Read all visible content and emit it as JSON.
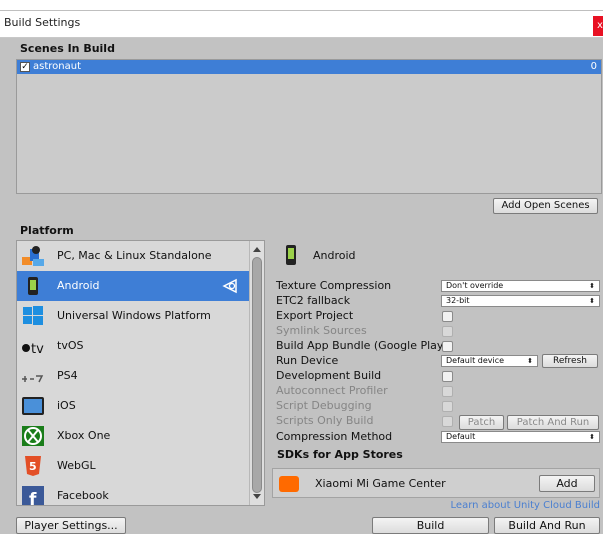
{
  "window": {
    "title": "Build Settings",
    "close_label": "x"
  },
  "scenes": {
    "heading": "Scenes In Build",
    "items": [
      {
        "name": "astronaut",
        "index": "0",
        "checked": true
      }
    ],
    "add_open_scenes_label": "Add Open Scenes"
  },
  "platform": {
    "heading": "Platform",
    "items": [
      {
        "label": "PC, Mac & Linux Standalone",
        "icon": "pc-mac-linux-icon"
      },
      {
        "label": "Android",
        "icon": "android-icon",
        "selected": true
      },
      {
        "label": "Universal Windows Platform",
        "icon": "windows-icon"
      },
      {
        "label": "tvOS",
        "icon": "apple-tv-icon"
      },
      {
        "label": "PS4",
        "icon": "ps4-icon"
      },
      {
        "label": "iOS",
        "icon": "ios-icon"
      },
      {
        "label": "Xbox One",
        "icon": "xbox-icon"
      },
      {
        "label": "WebGL",
        "icon": "html5-icon"
      },
      {
        "label": "Facebook",
        "icon": "facebook-icon"
      }
    ]
  },
  "settings": {
    "title": "Android",
    "texture_compression": {
      "label": "Texture Compression",
      "value": "Don't override"
    },
    "etc2_fallback": {
      "label": "ETC2 fallback",
      "value": "32-bit"
    },
    "export_project": {
      "label": "Export Project"
    },
    "symlink_sources": {
      "label": "Symlink Sources"
    },
    "build_app_bundle": {
      "label": "Build App Bundle (Google Play)"
    },
    "run_device": {
      "label": "Run Device",
      "value": "Default device",
      "refresh_label": "Refresh"
    },
    "development_build": {
      "label": "Development Build"
    },
    "autoconnect_profiler": {
      "label": "Autoconnect Profiler"
    },
    "script_debugging": {
      "label": "Script Debugging"
    },
    "scripts_only_build": {
      "label": "Scripts Only Build",
      "patch_label": "Patch",
      "patch_and_run_label": "Patch And Run"
    },
    "compression_method": {
      "label": "Compression Method",
      "value": "Default"
    }
  },
  "sdks": {
    "heading": "SDKs for App Stores",
    "items": [
      {
        "label": "Xiaomi Mi Game Center",
        "add_label": "Add"
      }
    ],
    "cloud_link": "Learn about Unity Cloud Build"
  },
  "footer": {
    "player_settings_label": "Player Settings...",
    "build_label": "Build",
    "build_and_run_label": "Build And Run"
  },
  "colors": {
    "selection": "#3e7ed6",
    "panel": "#c2c2c2",
    "link": "#4a7fd0",
    "close": "#e81123"
  }
}
